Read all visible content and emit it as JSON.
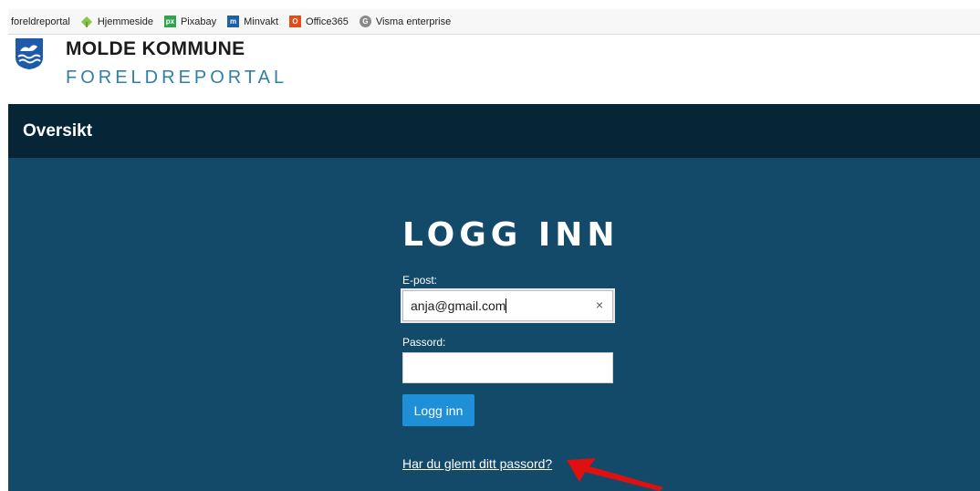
{
  "bookmarks": [
    {
      "label": "foreldreportal",
      "icon": "none",
      "color": ""
    },
    {
      "label": "Hjemmeside",
      "icon": "green-diamond-icon",
      "color": "#7cb342"
    },
    {
      "label": "Pixabay",
      "icon": "pixabay-icon",
      "color": "#2ea44f",
      "glyph": "px"
    },
    {
      "label": "Minvakt",
      "icon": "minvakt-icon",
      "color": "#1f5fa8",
      "glyph": "m"
    },
    {
      "label": "Office365",
      "icon": "office-icon",
      "color": "#e64a19",
      "glyph": "O"
    },
    {
      "label": "Visma enterprise",
      "icon": "visma-icon",
      "color": "#8a8a8a",
      "glyph": "G"
    }
  ],
  "header": {
    "brand_name": "MOLDE KOMMUNE",
    "brand_sub": "FORELDREPORTAL",
    "logo_icon": "molde-coat-of-arms-icon"
  },
  "nav": {
    "overview_label": "Oversikt"
  },
  "login": {
    "title": "LOGG INN",
    "email_label": "E-post:",
    "email_value": "anja@gmail.com",
    "clear_glyph": "×",
    "password_label": "Passord:",
    "password_value": "",
    "submit_label": "Logg inn",
    "forgot_label": "Har du glemt ditt passord?"
  },
  "colors": {
    "nav_bg": "#062637",
    "main_bg": "#134a69",
    "button_bg": "#1f8fd8",
    "brand_sub": "#2f7fa8",
    "annotation_arrow": "#e01010"
  }
}
